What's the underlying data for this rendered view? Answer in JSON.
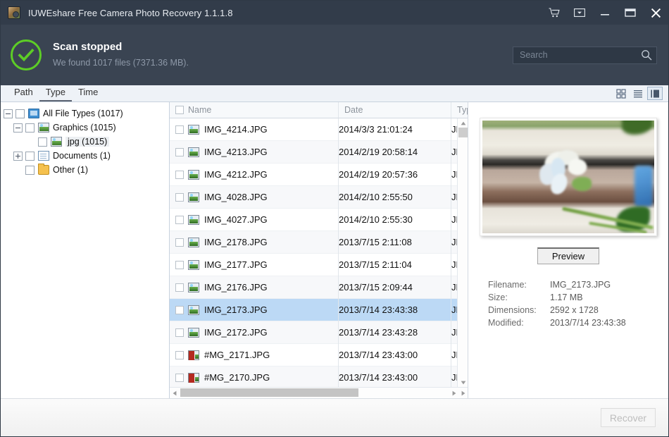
{
  "window": {
    "title": "IUWEshare Free Camera Photo Recovery 1.1.1.8",
    "app_icon": "camera-photo-icon",
    "controls": [
      {
        "name": "cart-button",
        "icon": "shopping-cart-icon"
      },
      {
        "name": "dropdown-button",
        "icon": "chevron-down-boxed-icon"
      },
      {
        "name": "minimize-button",
        "icon": "minimize-icon"
      },
      {
        "name": "maximize-button",
        "icon": "maximize-icon"
      },
      {
        "name": "close-button",
        "icon": "close-icon"
      }
    ]
  },
  "status": {
    "icon": "check-circle-icon",
    "accent_color": "#5dcd26",
    "title": "Scan stopped",
    "subtitle": "We found 1017 files (7371.36 MB)."
  },
  "search": {
    "placeholder": "Search",
    "value": "",
    "icon": "search-icon"
  },
  "tabs": [
    {
      "label": "Path",
      "active": false
    },
    {
      "label": "Type",
      "active": true
    },
    {
      "label": "Time",
      "active": false
    }
  ],
  "view_modes": [
    {
      "name": "grid-view-icon",
      "active": false
    },
    {
      "name": "list-view-icon",
      "active": false
    },
    {
      "name": "detail-view-icon",
      "active": true
    }
  ],
  "tree": {
    "nodes": [
      {
        "label": "All File Types (1017)",
        "icon": "monitor-icon",
        "expander": "minus",
        "level": 0,
        "selected": false
      },
      {
        "label": "Graphics (1015)",
        "icon": "photo-icon",
        "expander": "minus",
        "level": 1,
        "selected": false
      },
      {
        "label": "jpg (1015)",
        "icon": "photo-icon",
        "expander": "none",
        "level": 2,
        "selected": true
      },
      {
        "label": "Documents (1)",
        "icon": "document-icon",
        "expander": "plus",
        "level": 1,
        "selected": false
      },
      {
        "label": "Other (1)",
        "icon": "folder-icon",
        "expander": "none",
        "level": 1,
        "selected": false
      }
    ]
  },
  "file_list": {
    "columns": [
      {
        "label": "Name",
        "has_checkbox": true
      },
      {
        "label": "Date",
        "has_checkbox": false
      },
      {
        "label": "Typ",
        "has_checkbox": false
      }
    ],
    "rows": [
      {
        "name": "IMG_4214.JPG",
        "date": "2014/3/3 21:01:24",
        "type": "JPI",
        "icon": "image-file-icon",
        "selected": false
      },
      {
        "name": "IMG_4213.JPG",
        "date": "2014/2/19 20:58:14",
        "type": "JPI",
        "icon": "image-file-icon",
        "selected": false
      },
      {
        "name": "IMG_4212.JPG",
        "date": "2014/2/19 20:57:36",
        "type": "JPI",
        "icon": "image-file-icon",
        "selected": false
      },
      {
        "name": "IMG_4028.JPG",
        "date": "2014/2/10 2:55:50",
        "type": "JPI",
        "icon": "image-file-icon",
        "selected": false
      },
      {
        "name": "IMG_4027.JPG",
        "date": "2014/2/10 2:55:30",
        "type": "JPI",
        "icon": "image-file-icon",
        "selected": false
      },
      {
        "name": "IMG_2178.JPG",
        "date": "2013/7/15 2:11:08",
        "type": "JPI",
        "icon": "image-file-icon",
        "selected": false
      },
      {
        "name": "IMG_2177.JPG",
        "date": "2013/7/15 2:11:04",
        "type": "JPI",
        "icon": "image-file-icon",
        "selected": false
      },
      {
        "name": "IMG_2176.JPG",
        "date": "2013/7/15 2:09:44",
        "type": "JPI",
        "icon": "image-file-icon",
        "selected": false
      },
      {
        "name": "IMG_2173.JPG",
        "date": "2013/7/14 23:43:38",
        "type": "JPI",
        "icon": "image-file-icon",
        "selected": true
      },
      {
        "name": "IMG_2172.JPG",
        "date": "2013/7/14 23:43:28",
        "type": "JPI",
        "icon": "image-file-icon",
        "selected": false
      },
      {
        "name": "#MG_2171.JPG",
        "date": "2013/7/14 23:43:00",
        "type": "JPI",
        "icon": "damaged-file-icon",
        "selected": false
      },
      {
        "name": "#MG_2170.JPG",
        "date": "2013/7/14 23:43:00",
        "type": "JPI",
        "icon": "damaged-file-icon",
        "selected": false
      }
    ]
  },
  "preview": {
    "thumbnail_alt": "jasmine-flower-photo",
    "button_label": "Preview",
    "details": [
      {
        "key": "Filename:",
        "value": "IMG_2173.JPG"
      },
      {
        "key": "Size:",
        "value": "1.17 MB"
      },
      {
        "key": "Dimensions:",
        "value": "2592 x 1728"
      },
      {
        "key": "Modified:",
        "value": "2013/7/14 23:43:38"
      }
    ]
  },
  "footer": {
    "recover_label": "Recover",
    "recover_enabled": false
  }
}
